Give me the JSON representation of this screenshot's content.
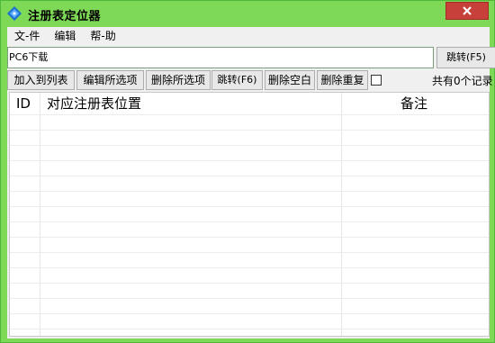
{
  "window": {
    "title": "注册表定位器",
    "accent_color": "#7ed957",
    "close_color": "#c7413a"
  },
  "menu": {
    "items": [
      "文-件",
      "编辑",
      "帮-助"
    ]
  },
  "path_input": {
    "value": "PC6下载"
  },
  "buttons": {
    "jump_top": "跳转(F5)",
    "add_to_list": "加入到列表",
    "edit_selected": "编辑所选项",
    "delete_selected": "删除所选项",
    "jump": "跳转(F6)",
    "delete_blank": "删除空白",
    "delete_duplicate": "删除重复"
  },
  "status": {
    "count_text": "共有0个记录"
  },
  "list": {
    "columns": [
      "ID",
      "对应注册表位置",
      "备注"
    ],
    "rows": []
  }
}
